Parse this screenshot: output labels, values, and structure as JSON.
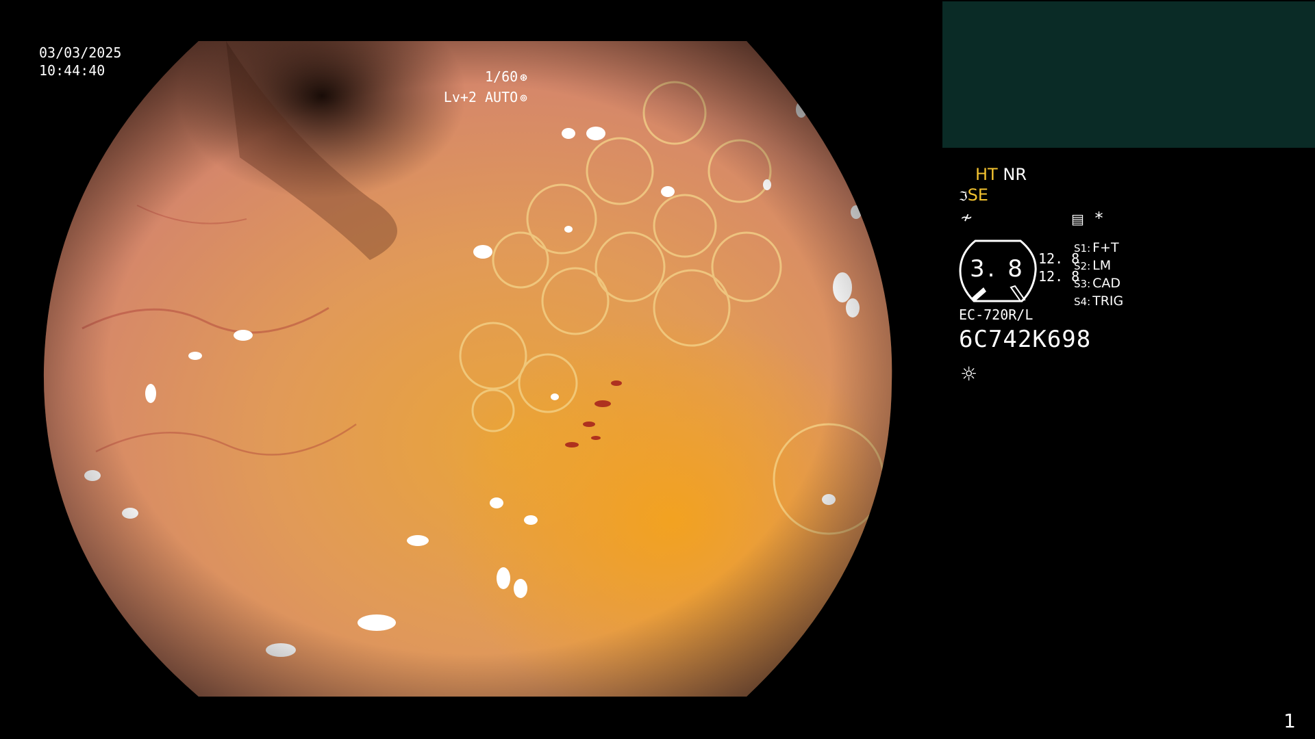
{
  "overlay": {
    "date": "03/03/2025",
    "time": "10:44:40",
    "shutter": "1/60",
    "shutter_icon": "shutter-icon",
    "level": "Lv+2 AUTO",
    "level_icon": "auto-iris-icon"
  },
  "panel": {
    "ht": "HT",
    "nr": "NR",
    "se": "SE",
    "freeze_icon": "freeze-icon",
    "memo_icon": "memo-icon",
    "asterisk": "*",
    "gauge_value": "3. 8",
    "side_top": "12. 8",
    "side_bottom": "12. 8",
    "switches": [
      {
        "key": "S1:",
        "value": "F+T"
      },
      {
        "key": "S2:",
        "value": "LM"
      },
      {
        "key": "S3:",
        "value": "CAD"
      },
      {
        "key": "S4:",
        "value": "TRIG"
      }
    ],
    "model": "EC-720R/L",
    "serial": "6C742K698",
    "light_icon": "sun-icon"
  },
  "page_number": "1",
  "colors": {
    "accent_yellow": "#f2c230",
    "thumbnail_bg": "#0a2b26"
  }
}
